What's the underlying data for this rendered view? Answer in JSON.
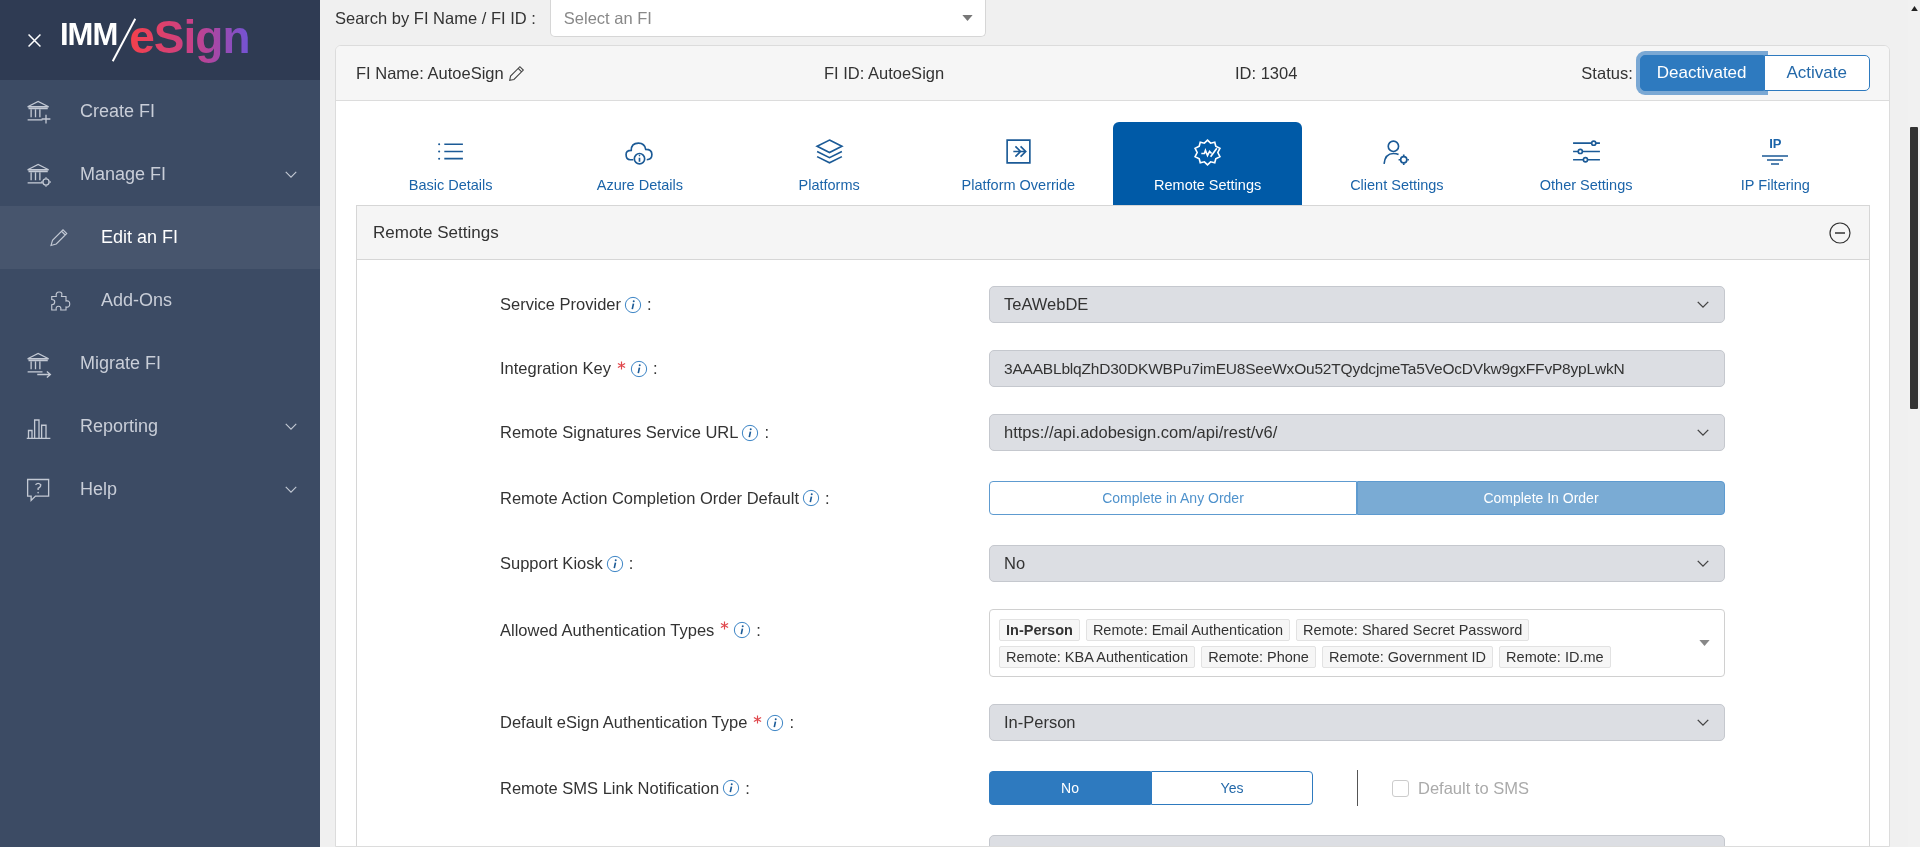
{
  "logo": {
    "text_left": "IMM",
    "text_right": "eSign"
  },
  "sidebar": {
    "items": [
      {
        "label": "Create FI",
        "selected": false,
        "has_submenu": false
      },
      {
        "label": "Manage FI",
        "selected": false,
        "has_submenu": true,
        "children": [
          {
            "label": "Edit an FI",
            "selected": true
          },
          {
            "label": "Add-Ons",
            "selected": false
          }
        ]
      },
      {
        "label": "Migrate FI",
        "selected": false,
        "has_submenu": false
      },
      {
        "label": "Reporting",
        "selected": false,
        "has_submenu": true
      },
      {
        "label": "Help",
        "selected": false,
        "has_submenu": true
      }
    ]
  },
  "search": {
    "label": "Search by FI Name / FI ID :",
    "placeholder": "Select an FI"
  },
  "fi_header": {
    "name": "FI Name: AutoeSign",
    "fi_id": "FI ID: AutoeSign",
    "id": "ID: 1304",
    "status_label": "Status:",
    "status_options": [
      {
        "label": "Deactivated",
        "selected": true
      },
      {
        "label": "Activate",
        "selected": false
      }
    ]
  },
  "tabs": [
    {
      "label": "Basic Details",
      "selected": false
    },
    {
      "label": "Azure Details",
      "selected": false
    },
    {
      "label": "Platforms",
      "selected": false
    },
    {
      "label": "Platform Override",
      "selected": false
    },
    {
      "label": "Remote Settings",
      "selected": true
    },
    {
      "label": "Client Settings",
      "selected": false
    },
    {
      "label": "Other Settings",
      "selected": false
    },
    {
      "label": "IP Filtering",
      "selected": false,
      "icon_label": "IP"
    }
  ],
  "section": {
    "title": "Remote Settings",
    "expanded": true
  },
  "fields": [
    {
      "kind": "select",
      "label": "Service Provider",
      "required": false,
      "suffix": ":",
      "value": "TeAWebDE"
    },
    {
      "kind": "text",
      "label": "Integration Key",
      "required": true,
      "suffix": ":",
      "value": "3AAABLblqZhD30DKWBPu7imEU8SeeWxOu52TQydcjmeTa5VeOcDVkw9gxFFvP8ypLwkN"
    },
    {
      "kind": "select",
      "label": "Remote Signatures Service URL",
      "required": false,
      "suffix": ":",
      "value": "https://api.adobesign.com/api/rest/v6/"
    },
    {
      "kind": "segmented",
      "label": "Remote Action Completion Order Default",
      "required": false,
      "suffix": ":",
      "disabled": true,
      "options": [
        {
          "label": "Complete in Any Order",
          "selected": false
        },
        {
          "label": "Complete In Order",
          "selected": true
        }
      ]
    },
    {
      "kind": "select",
      "label": "Support Kiosk",
      "required": false,
      "suffix": ":",
      "value": "No"
    },
    {
      "kind": "multiselect",
      "label": "Allowed Authentication Types",
      "required": true,
      "suffix": ":",
      "tags": [
        {
          "label": "In-Person",
          "selected": true
        },
        {
          "label": "Remote: Email Authentication",
          "selected": false
        },
        {
          "label": "Remote: Shared Secret Password",
          "selected": false
        },
        {
          "label": "Remote: KBA Authentication",
          "selected": false
        },
        {
          "label": "Remote: Phone",
          "selected": false
        },
        {
          "label": "Remote: Government ID",
          "selected": false
        },
        {
          "label": "Remote: ID.me",
          "selected": false
        }
      ]
    },
    {
      "kind": "select",
      "label": "Default eSign Authentication Type",
      "required": true,
      "suffix": ":",
      "value": "In-Person"
    },
    {
      "kind": "segmented",
      "label": "Remote SMS Link Notification",
      "required": false,
      "suffix": ":",
      "disabled": false,
      "options": [
        {
          "label": "No",
          "selected": true
        },
        {
          "label": "Yes",
          "selected": false
        }
      ],
      "checkbox": {
        "label": "Default to SMS",
        "checked": false,
        "disabled": true
      }
    },
    {
      "kind": "select"
    }
  ]
}
